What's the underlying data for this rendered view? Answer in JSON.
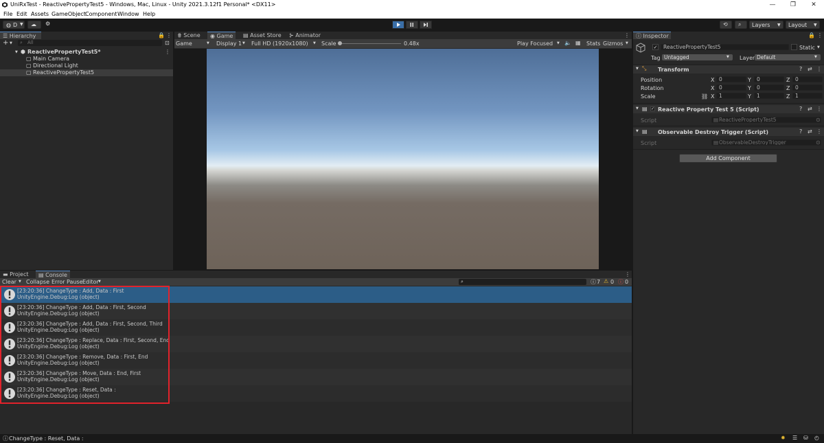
{
  "window": {
    "title": "UniRxTest - ReactivePropertyTest5 - Windows, Mac, Linux - Unity 2021.3.12f1 Personal* <DX11>"
  },
  "menu": [
    "File",
    "Edit",
    "Assets",
    "GameObject",
    "Component",
    "Window",
    "Help"
  ],
  "toolbar": {
    "account": "D",
    "layers": "Layers",
    "layout": "Layout"
  },
  "hierarchy": {
    "tab": "Hierarchy",
    "search_placeholder": "All",
    "scene": "ReactivePropertyTest5*",
    "items": [
      "Main Camera",
      "Directional Light",
      "ReactivePropertyTest5"
    ]
  },
  "center_tabs": [
    "Scene",
    "Game",
    "Asset Store",
    "Animator"
  ],
  "game_bar": {
    "mode": "Game",
    "display": "Display 1",
    "resolution": "Full HD (1920x1080)",
    "scale_label": "Scale",
    "scale_value": "0.48x",
    "play_focused": "Play Focused",
    "stats": "Stats",
    "gizmos": "Gizmos"
  },
  "inspector": {
    "tab": "Inspector",
    "object_name": "ReactivePropertyTest5",
    "static_label": "Static",
    "tag_label": "Tag",
    "tag_value": "Untagged",
    "layer_label": "Layer",
    "layer_value": "Default",
    "transform": {
      "title": "Transform",
      "position_label": "Position",
      "rotation_label": "Rotation",
      "scale_label": "Scale",
      "position": [
        "0",
        "0",
        "0"
      ],
      "rotation": [
        "0",
        "0",
        "0"
      ],
      "scale": [
        "1",
        "1",
        "1"
      ]
    },
    "axes": [
      "X",
      "Y",
      "Z"
    ],
    "comp1": {
      "title": "Reactive Property Test 5 (Script)",
      "script_label": "Script",
      "script_value": "ReactivePropertyTest5"
    },
    "comp2": {
      "title": "Observable Destroy Trigger (Script)",
      "script_label": "Script",
      "script_value": "ObservableDestroyTrigger"
    },
    "add_component": "Add Component"
  },
  "bottom_tabs": [
    "Project",
    "Console"
  ],
  "console_bar": {
    "clear": "Clear",
    "collapse": "Collapse",
    "error_pause": "Error Pause",
    "editor": "Editor",
    "log_count": "7",
    "warn_count": "0",
    "error_count": "0"
  },
  "console_logs": [
    {
      "line1": "[23:20:36] ChangeType : Add, Data : First",
      "line2": "UnityEngine.Debug:Log (object)"
    },
    {
      "line1": "[23:20:36] ChangeType : Add, Data : First, Second",
      "line2": "UnityEngine.Debug:Log (object)"
    },
    {
      "line1": "[23:20:36] ChangeType : Add, Data : First, Second, Third",
      "line2": "UnityEngine.Debug:Log (object)"
    },
    {
      "line1": "[23:20:36] ChangeType : Replace, Data : First, Second, End",
      "line2": "UnityEngine.Debug:Log (object)"
    },
    {
      "line1": "[23:20:36] ChangeType : Remove, Data : First, End",
      "line2": "UnityEngine.Debug:Log (object)"
    },
    {
      "line1": "[23:20:36] ChangeType : Move, Data : End, First",
      "line2": "UnityEngine.Debug:Log (object)"
    },
    {
      "line1": "[23:20:36] ChangeType : Reset, Data :",
      "line2": "UnityEngine.Debug:Log (object)"
    }
  ],
  "status_bar": {
    "message": "ChangeType : Reset, Data :"
  },
  "colors": {
    "selection": "#2c5d87",
    "highlight_box": "#e3222b",
    "play_active": "#3a6fa8"
  }
}
